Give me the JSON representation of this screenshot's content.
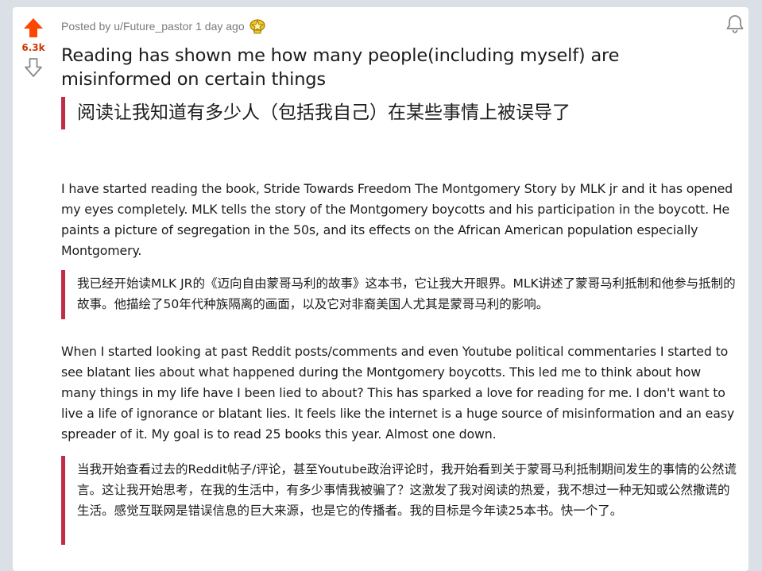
{
  "post": {
    "vote_score": "6.3k",
    "meta": {
      "posted_by_prefix": "Posted by",
      "username": "u/Future_pastor",
      "time_ago": "1 day ago"
    },
    "title": "Reading has shown me how many people(including myself) are misinformed on certain things",
    "title_translation": "阅读让我知道有多少人（包括我自己）在某些事情上被误导了",
    "body": [
      {
        "text": "I have started reading the book, Stride Towards Freedom The Montgomery Story by MLK jr and it has opened my eyes completely. MLK tells the story of the Montgomery boycotts and his participation in the boycott. He paints a picture of segregation in the 50s, and its effects on the African American population especially Montgomery.",
        "translation": "我已经开始读MLK JR的《迈向自由蒙哥马利的故事》这本书，它让我大开眼界。MLK讲述了蒙哥马利抵制和他参与抵制的故事。他描绘了50年代种族隔离的画面，以及它对非裔美国人尤其是蒙哥马利的影响。"
      },
      {
        "text": "When I started looking at past Reddit posts/comments and even Youtube political commentaries I started to see blatant lies about what happened during the Montgomery boycotts. This led me to think about how many things in my life have I been lied to about? This has sparked a love for reading for me. I don't want to live a life of ignorance or blatant lies. It feels like the internet is a huge source of misinformation and an easy spreader of it. My goal is to read 25 books this year. Almost one down.",
        "translation": "当我开始查看过去的Reddit帖子/评论，甚至Youtube政治评论时，我开始看到关于蒙哥马利抵制期间发生的事情的公然谎言。这让我开始思考，在我的生活中，有多少事情我被骗了？这激发了我对阅读的热爱，我不想过一种无知或公然撒谎的生活。感觉互联网是错误信息的巨大来源，也是它的传播者。我的目标是今年读25本书。快一个了。"
      }
    ]
  },
  "icons": {
    "upvote": "upvote-arrow-icon",
    "downvote": "downvote-arrow-icon",
    "award": "award-icon",
    "bell": "bell-icon"
  },
  "colors": {
    "upvote_active": "#ff4500",
    "score": "#cc3700",
    "quote_bar": "#c02d48",
    "meta_text": "#787c7e"
  }
}
